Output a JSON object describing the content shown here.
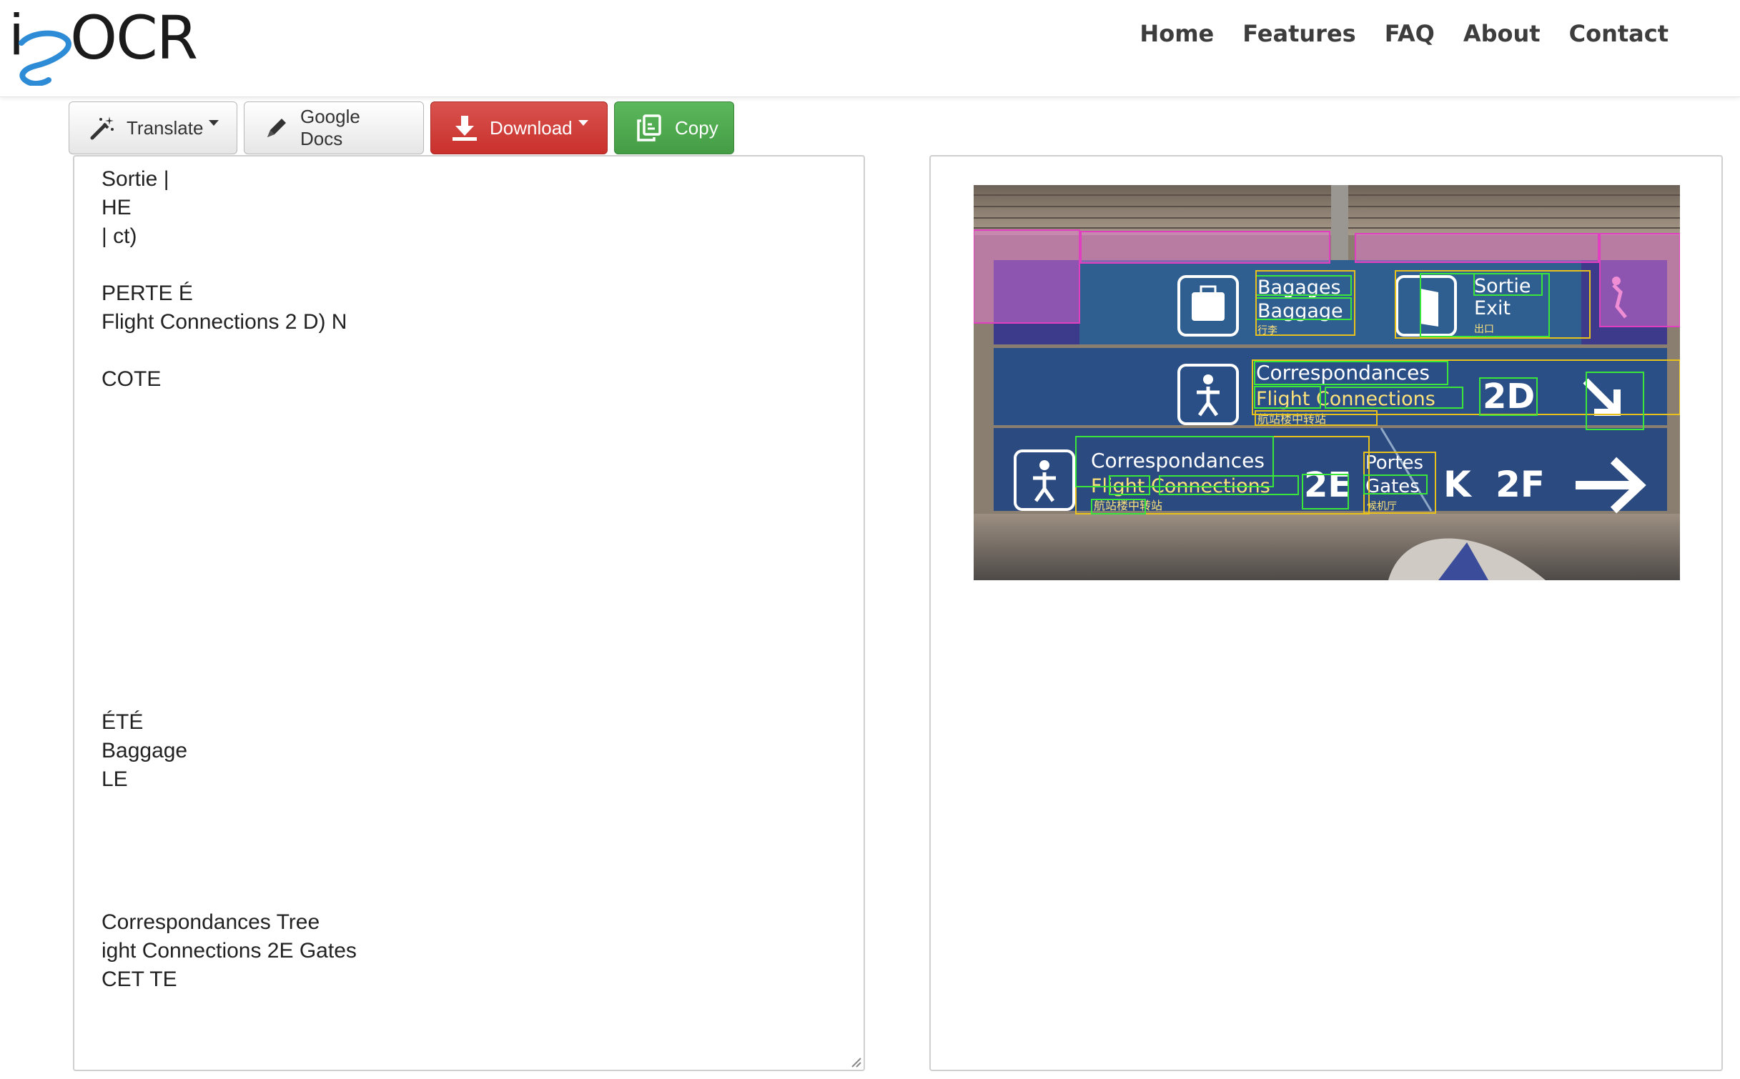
{
  "brand": {
    "logo_i": "i",
    "logo_ocr": "OCR"
  },
  "nav": {
    "home": "Home",
    "features": "Features",
    "faq": "FAQ",
    "about": "About",
    "contact": "Contact"
  },
  "toolbar": {
    "translate": "Translate",
    "google_docs": "Google Docs",
    "download": "Download",
    "copy": "Copy"
  },
  "ocr_output": {
    "text": "Sortie |\nHE\n| ct)\n\nPERTE É\nFlight Connections 2 D) N\n\nCOTE\n\n\n\n\n\n\n\n\n\n\n\nÉTÉ\nBaggage\nLE\n\n\n\n\nCorrespondances Tree\night Connections 2E Gates\nCET TE"
  },
  "image": {
    "row1": {
      "bagages": "Bagages",
      "baggage": "Baggage",
      "bagages_zh": "行李",
      "sortie": "Sortie",
      "exit": "Exit",
      "exit_zh": "出口"
    },
    "row2": {
      "correspondances": "Correspondances",
      "flight_connections": "Flight Connections",
      "gate": "2D",
      "zh": "航站楼中转站"
    },
    "row3": {
      "correspondances": "Correspondances",
      "flight_connections": "Flight Connections",
      "gate": "2E",
      "portes": "Portes",
      "gates": "Gates",
      "portes_zh": "候机厅",
      "k": "K",
      "gate2": "2F",
      "zh": "航站楼中转站"
    }
  },
  "colors": {
    "sign_blue": "#2d5c8f",
    "box_green": "#39e639",
    "box_yellow": "#e8c21a",
    "box_magenta": "#e040c0",
    "danger": "#d9534f",
    "success": "#5cb85c"
  },
  "icons": [
    "magic-wand-icon",
    "pencil-icon",
    "download-icon",
    "copy-icon"
  ]
}
